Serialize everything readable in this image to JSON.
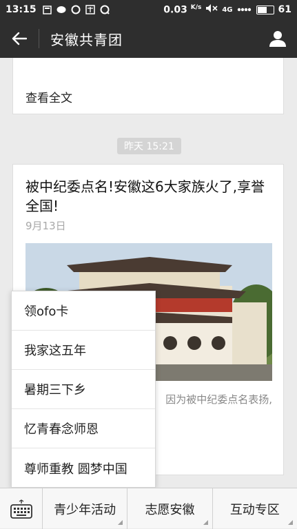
{
  "status_bar": {
    "time": "13:15",
    "net_speed": "0.03",
    "net_unit": "K/s",
    "network": "4G",
    "battery": "61",
    "battery_level": 0.61
  },
  "header": {
    "title": "安徽共青团"
  },
  "previous_card": {
    "read_more": "查看全文"
  },
  "timestamp": "昨天 15:21",
  "article": {
    "headline": "被中纪委点名!安徽这6大家族火了,享誉全国!",
    "date": "9月13日",
    "summary_partial": "因为被中纪委点名表扬,"
  },
  "popup_menu": {
    "items": [
      "领ofo卡",
      "我家这五年",
      "暑期三下乡",
      "忆青春念师恩",
      "尊师重教 圆梦中国"
    ]
  },
  "bottom_menu": {
    "tabs": [
      "青少年活动",
      "志愿安徽",
      "互动专区"
    ]
  },
  "colors": {
    "header_bg": "#2e2e2e",
    "page_bg": "#ebebeb",
    "timestamp_bg": "#d4d4d4"
  }
}
